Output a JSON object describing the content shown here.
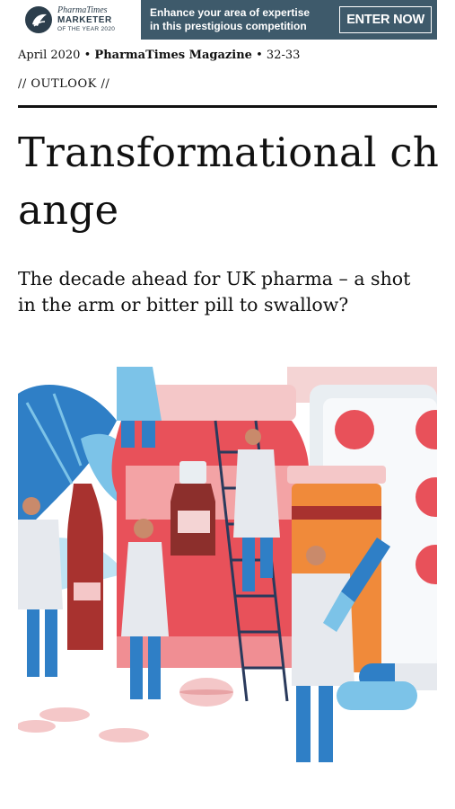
{
  "banner": {
    "logo_line1": "PharmaTimes",
    "logo_line2": "MARKETER",
    "logo_line3": "OF THE YEAR 2020",
    "ad_line1": "Enhance your area of expertise",
    "ad_line2": "in this prestigious competition",
    "cta_label": "ENTER NOW",
    "bg_color": "#3e5a6b"
  },
  "meta": {
    "date": "April 2020",
    "separator": "•",
    "publication": "PharmaTimes Magazine",
    "pages": "32-33"
  },
  "article": {
    "section": "// OUTLOOK //",
    "title": "Transformational change",
    "subtitle": "The decade ahead for UK pharma – a shot in the arm or bitter pill to swallow?"
  },
  "hero": {
    "icon": "pharmacy-illustration",
    "colors": {
      "red": "#e8515a",
      "blue": "#2f7fc6",
      "light_blue": "#7cc3e8",
      "pink": "#f4c7c8",
      "orange": "#f08a3a",
      "dark_red": "#a8322f"
    }
  }
}
